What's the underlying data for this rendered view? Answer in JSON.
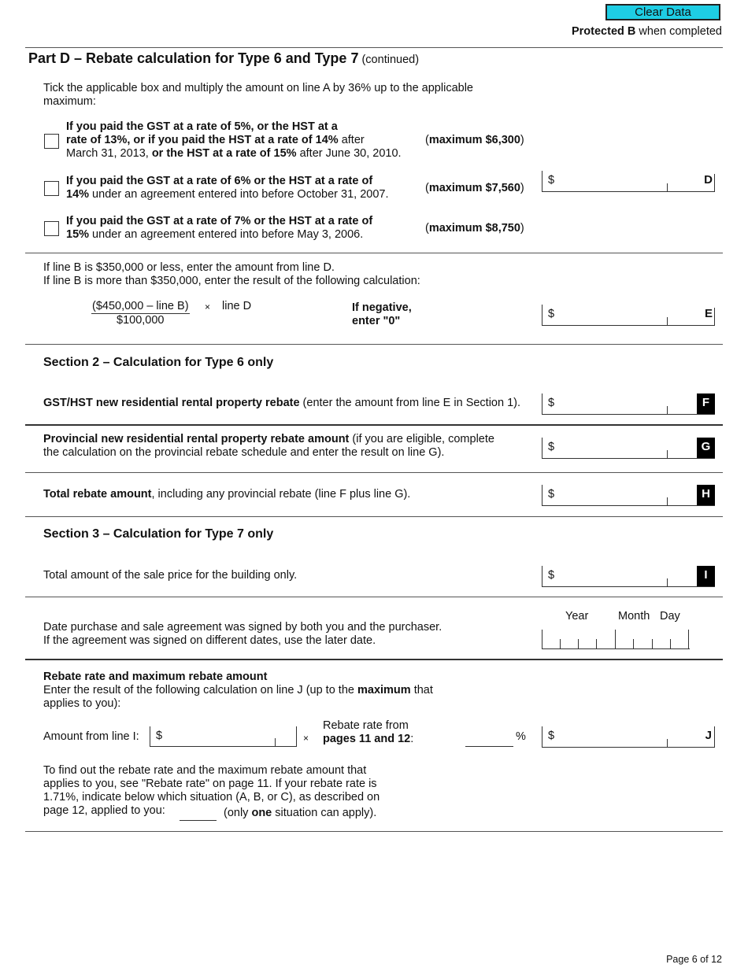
{
  "header": {
    "clear_button": "Clear Data",
    "protected_bold": "Protected B",
    "protected_rest": " when completed"
  },
  "part_d": {
    "title": "Part D – Rebate calculation for Type 6 and Type 7",
    "title_suffix": " (continued)",
    "instruction_line1": "Tick the applicable box and multiply the amount on line A by 36% up to the applicable",
    "instruction_line2": "maximum:",
    "options": [
      {
        "line1": "If you paid the GST at a rate of 5%, or the HST at a",
        "line2_bold": "rate of 13%, or if you paid the HST at a rate of 14%",
        "line2_rest": " after",
        "line3_a": "March 31, 2013, ",
        "line3_bold": "or the HST at a rate of 15%",
        "line3_b": " after June 30, 2010.",
        "max_prefix": "(",
        "max_bold": "maximum $6,300",
        "max_suffix": ")",
        "checked": false
      },
      {
        "line1": "If you paid the GST at a rate of 6% or the HST at a rate of",
        "line2_bold": "14%",
        "line2_rest": " under an agreement entered into before October 31, 2007.",
        "max_prefix": "(",
        "max_bold": "maximum $7,560",
        "max_suffix": ")",
        "checked": false
      },
      {
        "line1": "If you paid the GST at a rate of 7% or the HST at a rate of",
        "line2_bold": "15%",
        "line2_rest": " under an agreement entered into before May 3, 2006.",
        "max_prefix": "(",
        "max_bold": "maximum $8,750",
        "max_suffix": ")",
        "checked": false
      }
    ],
    "line_d": {
      "currency": "$",
      "letter": "D",
      "value": ""
    },
    "line_e_text1": "If line B is $350,000 or less, enter the amount from line D.",
    "line_e_text2": "If line B is more than $350,000, enter the result of the following calculation:",
    "formula_numerator": "($450,000 – line B)",
    "formula_denominator": "$100,000",
    "formula_times": "×",
    "formula_line": "line D",
    "negative_line1": "If negative,",
    "negative_line2": "enter \"0\"",
    "line_e": {
      "currency": "$",
      "letter": "E",
      "value": ""
    }
  },
  "section2": {
    "title": "Section 2 – Calculation for Type 6 only",
    "line_f_bold": "GST/HST new residential rental property rebate",
    "line_f_rest": " (enter the amount from line E in Section 1).",
    "line_f": {
      "currency": "$",
      "letter": "F",
      "value": ""
    },
    "line_g_bold": "Provincial new residential rental property rebate amount",
    "line_g_rest": " (if you are eligible, complete",
    "line_g_line2": "the calculation on the provincial rebate schedule and enter the result on line G).",
    "line_g": {
      "currency": "$",
      "letter": "G",
      "value": ""
    },
    "line_h_bold": "Total rebate amount",
    "line_h_rest": ", including any provincial rebate (line F plus line G).",
    "line_h": {
      "currency": "$",
      "letter": "H",
      "value": ""
    }
  },
  "section3": {
    "title": "Section 3 – Calculation for Type 7 only",
    "line_i_text": "Total amount of the sale price for the building only.",
    "line_i": {
      "currency": "$",
      "letter": "I",
      "value": ""
    },
    "date_text1": "Date purchase and sale agreement was signed by both you and the purchaser.",
    "date_text2": "If the agreement was signed on different dates, use the later date.",
    "date_labels": {
      "year": "Year",
      "month": "Month",
      "day": "Day"
    },
    "rebate_heading": "Rebate rate and maximum rebate amount",
    "rebate_text1_a": "Enter the result of the following calculation on line J (up to the ",
    "rebate_text1_bold": "maximum",
    "rebate_text1_b": " that",
    "rebate_text2": "applies to you):",
    "amount_from_line_i": "Amount from line I:",
    "amount_currency": "$",
    "times": "×",
    "rate_label1": "Rebate rate from",
    "rate_label2_bold": "pages 11 and 12",
    "rate_label2_rest": ":",
    "percent": "%",
    "line_j": {
      "currency": "$",
      "letter": "J",
      "value": ""
    },
    "note_line1": "To find out the rebate rate and the maximum rebate amount that",
    "note_line2": "applies to you, see \"Rebate rate\" on page 11. If your rebate rate is",
    "note_line3": "1.71%, indicate below which situation (A, B, or C), as described on",
    "note_line4": "page 12, applied to you:",
    "note_line4_a": "(only ",
    "note_line4_bold": "one",
    "note_line4_b": " situation can apply)."
  },
  "footer": {
    "page": "Page 6 of 12"
  }
}
